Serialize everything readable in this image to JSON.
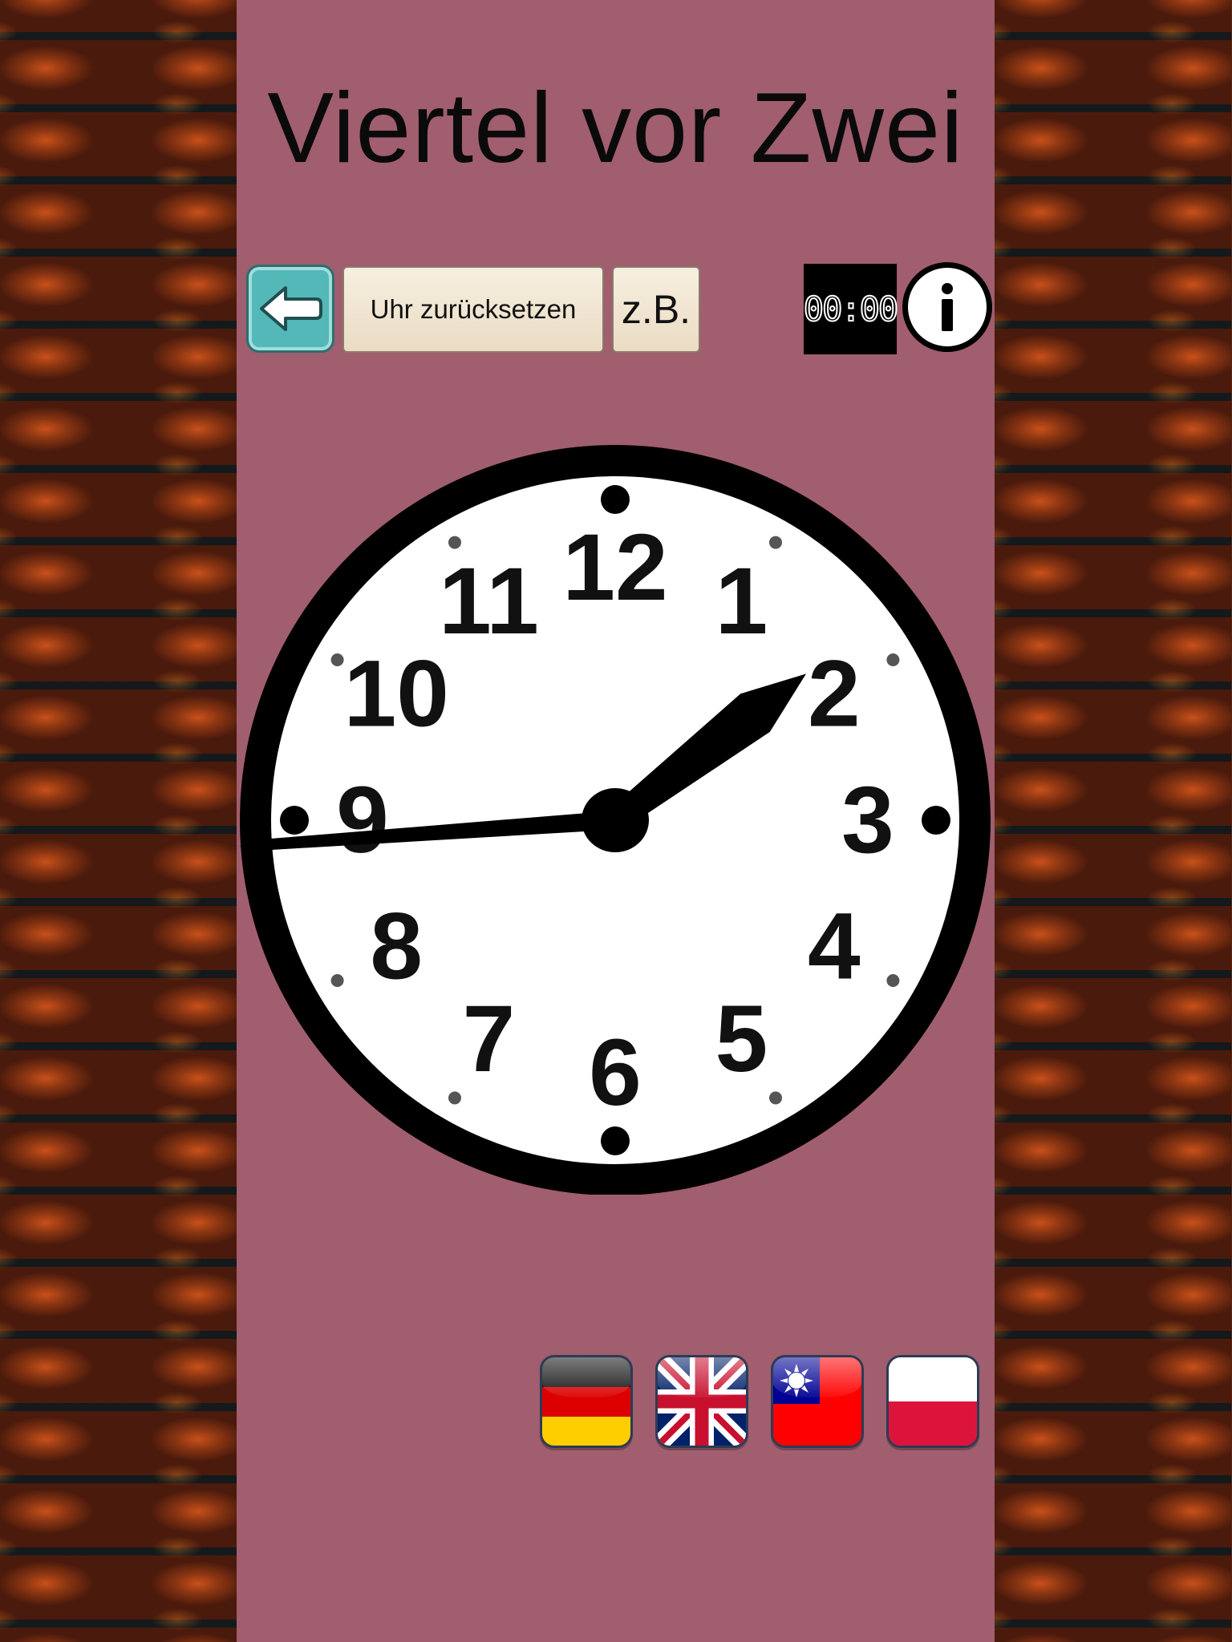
{
  "title": "Viertel vor Zwei",
  "toolbar": {
    "back_icon": "arrow-left-icon",
    "reset_label": "Uhr zurücksetzen",
    "example_label": "z.B.",
    "digital_display": "00:00",
    "info_label": "i"
  },
  "clock": {
    "numbers": [
      "12",
      "1",
      "2",
      "3",
      "4",
      "5",
      "6",
      "7",
      "8",
      "9",
      "10",
      "11"
    ],
    "time_shown": {
      "hour": 1,
      "minute": 45
    },
    "face_color": "#ffffff",
    "rim_color": "#000000"
  },
  "languages": [
    {
      "name": "Deutsch",
      "icon": "flag-germany-icon"
    },
    {
      "name": "English",
      "icon": "flag-uk-icon"
    },
    {
      "name": "中文",
      "icon": "flag-taiwan-icon"
    },
    {
      "name": "Polski",
      "icon": "flag-poland-icon"
    }
  ],
  "colors": {
    "panel": "#a05e6e",
    "back_button": "#55b8b8",
    "button_face": "#f2e6d0"
  }
}
